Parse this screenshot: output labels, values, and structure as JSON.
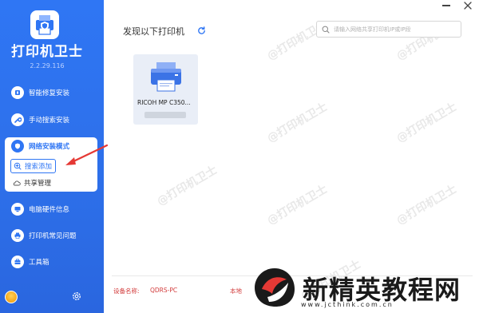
{
  "app": {
    "title": "打印机卫士",
    "version": "2.2.29.116"
  },
  "sidebar": {
    "items": [
      {
        "label": "智能修复安装",
        "icon": "repair-icon"
      },
      {
        "label": "手动搜索安装",
        "icon": "wrench-icon"
      },
      {
        "label": "网络安装模式",
        "icon": "network-icon"
      },
      {
        "label": "电脑硬件信息",
        "icon": "hardware-icon"
      },
      {
        "label": "打印机常见问题",
        "icon": "printer-icon"
      },
      {
        "label": "工具箱",
        "icon": "toolbox-icon"
      }
    ],
    "sub_items": [
      {
        "label": "搜索添加",
        "icon": "search-add-icon",
        "selected": true
      },
      {
        "label": "共享管理",
        "icon": "cloud-icon",
        "selected": false
      }
    ]
  },
  "main": {
    "title": "发现以下打印机",
    "search_placeholder": "请输入网络共享打印机IP或IP段",
    "printers": [
      {
        "name": "RICOH MP C350..."
      }
    ]
  },
  "footer": {
    "device_label": "设备名称:",
    "device_value": "QDRS-PC",
    "local_label": "本地"
  },
  "watermark": {
    "text": "@打印机卫士"
  },
  "brand": {
    "text": "新精英教程网",
    "url": "www.jcthink.com.cn"
  },
  "colors": {
    "sidebar": "#2f76f4",
    "accent": "#2f76f4",
    "footer_text": "#d23b3b",
    "arrow": "#e53935"
  }
}
